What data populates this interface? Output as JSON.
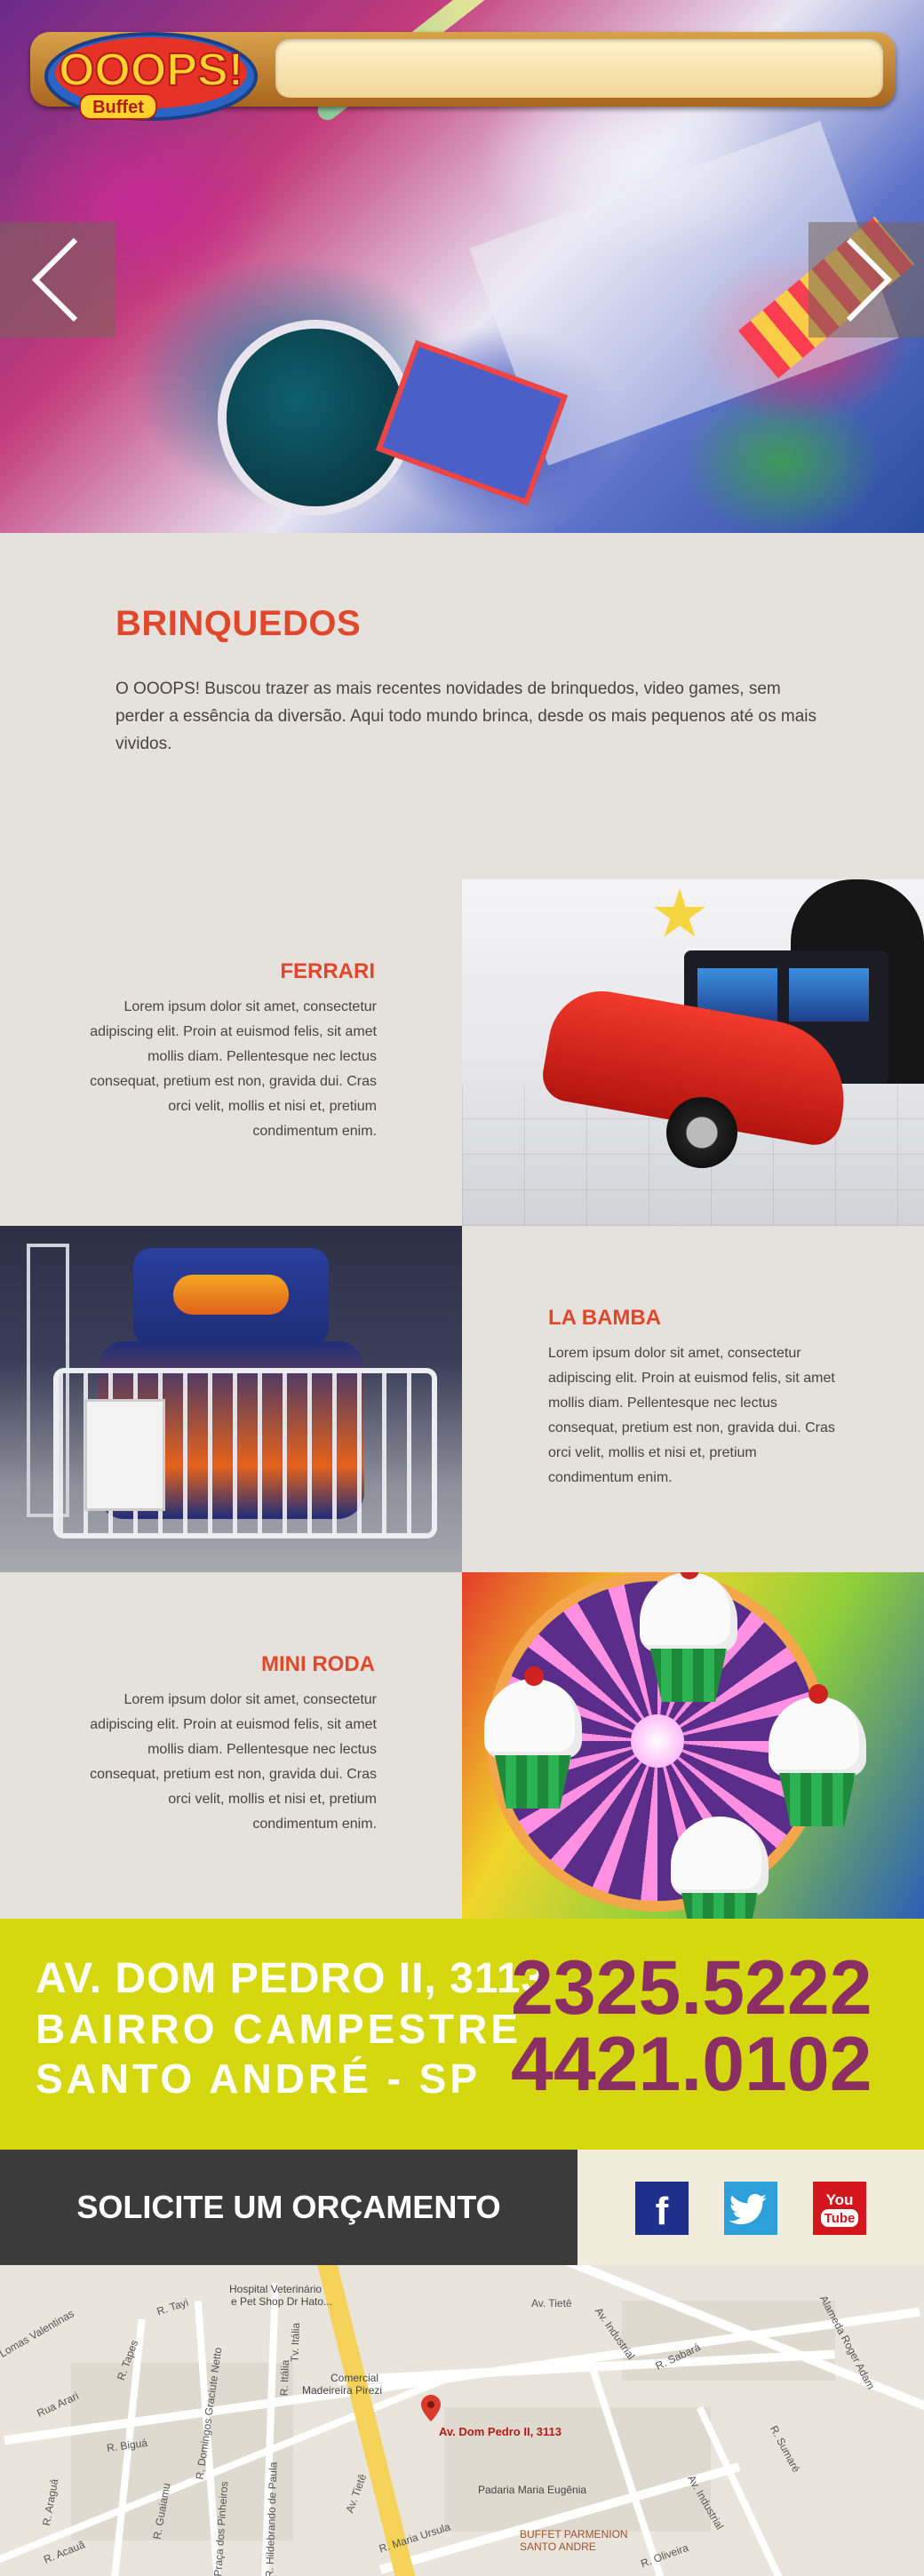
{
  "brand": {
    "logo_text": "OOOPS!",
    "logo_sub": "Buffet"
  },
  "slider": {
    "prev_icon": "chevron-left-icon",
    "next_icon": "chevron-right-icon"
  },
  "intro": {
    "title": "BRINQUEDOS",
    "text": "O OOOPS! Buscou trazer as mais recentes novidades de brinquedos, video games, sem perder a essência da diversão. Aqui todo mundo brinca, desde os mais pequenos até os mais vividos."
  },
  "toys": [
    {
      "title": "FERRARI",
      "text": "Lorem ipsum dolor sit amet, consectetur adipiscing elit. Proin at euismod felis, sit amet mollis diam. Pellentesque nec lectus consequat, pretium est non, gravida dui. Cras orci velit, mollis et nisi et, pretium condimentum enim."
    },
    {
      "title": "LA BAMBA",
      "text": "Lorem ipsum dolor sit amet, consectetur adipiscing elit. Proin at euismod felis, sit amet mollis diam. Pellentesque nec lectus consequat, pretium est non, gravida dui. Cras orci velit, mollis et nisi et, pretium condimentum enim."
    },
    {
      "title": "MINI RODA",
      "text": "Lorem ipsum dolor sit amet, consectetur adipiscing elit. Proin at euismod felis, sit amet mollis diam. Pellentesque nec lectus consequat, pretium est non, gravida dui. Cras orci velit, mollis et nisi et, pretium condimentum enim."
    }
  ],
  "contact": {
    "address_lines": [
      "AV. DOM PEDRO II, 3113",
      "BAIRRO CAMPESTRE",
      "SANTO ANDRÉ - SP"
    ],
    "phones": [
      "2325.5222",
      "4421.0102"
    ]
  },
  "cta": {
    "label": "SOLICITE UM ORÇAMENTO"
  },
  "social": {
    "facebook": "f",
    "youtube_top": "You",
    "youtube_bottom": "Tube"
  },
  "map": {
    "pin_label": "Av. Dom Pedro II, 3113",
    "labels": {
      "hospital": "Hospital Veterinário",
      "hospital2": "e Pet Shop Dr Hato...",
      "comercial": "Comercial",
      "madeireira": "Madeireira Pirezi",
      "padaria": "Padaria Maria Eugênia",
      "buffet": "BUFFET PARMENION",
      "buffet2": "SANTO ANDRE",
      "av_tiete": "Av. Tietê",
      "av_tiete2": "Av. Tietê",
      "av_industrial": "Av. Industrial",
      "av_industrial2": "Av. Industrial",
      "r_sabara": "R. Sabará",
      "alameda": "Alameda Roger Adam",
      "r_sumare": "R. Sumaré",
      "lomas": "Lomas Valentinas",
      "r_tapes": "R. Tapes",
      "rua_arari": "Rua Arari",
      "r_tayi": "R. Tayi",
      "r_biguá": "R. Biguá",
      "r_aragua": "R. Araguá",
      "r_acaua": "R. Acauã",
      "r_guaiamu": "R. Guaiamu",
      "r_domingos": "R. Domingos Graciute Netto",
      "dos_pinheiros": "Praça dos Pinheiros",
      "hildebrando": "R. Hildebrando de Paula",
      "maria_ursula": "R. Maria Ursula",
      "tv_italia": "Tv. Itália",
      "r_italia": "R. Itália",
      "oliveira": "R. Oliveira"
    }
  },
  "colors": {
    "accent": "#e1472b",
    "contact_bg": "#d5d80f",
    "phone": "#8a2e63",
    "cta_bg": "#3b3b3b",
    "facebook": "#1e2f8c",
    "twitter": "#2d9fd9",
    "youtube": "#d4161c"
  }
}
